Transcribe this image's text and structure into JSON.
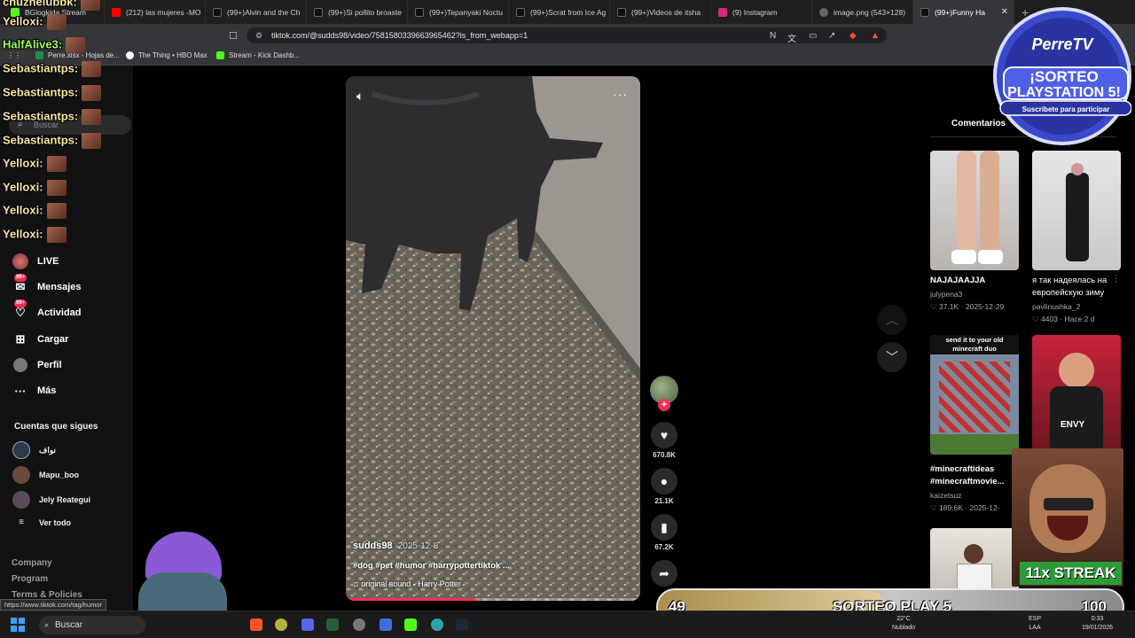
{
  "browser": {
    "tabs": [
      {
        "label": "BGlogkida Stream",
        "color": "#53fc18"
      },
      {
        "label": "(212) las mujeres -MO",
        "color": "#ff0000"
      },
      {
        "label": "(99+)Alvin and the Ch",
        "color": "#111111"
      },
      {
        "label": "(99+)Si pollito broaste",
        "color": "#111111"
      },
      {
        "label": "(99+)Tepanyaki Noctu",
        "color": "#111111"
      },
      {
        "label": "(99+)Scrat from Ice Ag",
        "color": "#111111"
      },
      {
        "label": "(99+)Videos de itsha",
        "color": "#111111"
      },
      {
        "label": "(9) Instagram",
        "color": "#d62976"
      },
      {
        "label": "image.png (543×128)",
        "color": "#666666"
      },
      {
        "label": "(99+)Funny Ha",
        "color": "#111111"
      }
    ],
    "url": "tiktok.com/@sudds98/video/7581580339663965462?is_from_webapp=1",
    "bookmarks": [
      {
        "label": "Perre.xlsx - Hojas de...",
        "color": "#1d8f4e"
      },
      {
        "label": "The Thing • HBO Max",
        "color": "#ffffff"
      },
      {
        "label": "Stream - Kick Dashb...",
        "color": "#53fc18"
      }
    ],
    "status_url": "https://www.tiktok.com/tag/humor"
  },
  "chat": [
    {
      "user": "chuzhelubbk:",
      "color": "#f6e6a0"
    },
    {
      "user": "Yelloxi:",
      "color": "#f6e6a0"
    },
    {
      "user": "HalfAlive3:",
      "color": "#9eff5a"
    },
    {
      "user": "Sebastiantps:",
      "color": "#f6e6a0"
    },
    {
      "user": "Sebastiantps:",
      "color": "#f6e6a0"
    },
    {
      "user": "Sebastiantps:",
      "color": "#f6e6a0"
    },
    {
      "user": "Sebastiantps:",
      "color": "#f6e6a0"
    },
    {
      "user": "Yelloxi:",
      "color": "#f6e6a0"
    },
    {
      "user": "Yelloxi:",
      "color": "#f6e6a0"
    },
    {
      "user": "Yelloxi:",
      "color": "#f6e6a0"
    },
    {
      "user": "Yelloxi:",
      "color": "#f6e6a0"
    }
  ],
  "sidebar": {
    "search_placeholder": "Buscar",
    "nav": [
      {
        "label": "LIVE",
        "icon": "live-icon"
      },
      {
        "label": "Mensajes",
        "icon": "messages-icon",
        "badge": "99+"
      },
      {
        "label": "Actividad",
        "icon": "activity-icon",
        "badge": "99+"
      },
      {
        "label": "Cargar",
        "icon": "upload-icon"
      },
      {
        "label": "Perfil",
        "icon": "profile-icon"
      },
      {
        "label": "Más",
        "icon": "more-icon"
      }
    ],
    "following_title": "Cuentas que sigues",
    "following": [
      {
        "name": "نواف"
      },
      {
        "name": "Mapu_boo"
      },
      {
        "name": "Jely Reategui"
      }
    ],
    "see_all": "Ver todo",
    "footer": [
      "Company",
      "Program",
      "Terms & Policies"
    ]
  },
  "video": {
    "author": "sudds98",
    "date": "2025-12-8",
    "tags": "#dog #pet #humor #harrypottertiktok ...",
    "sound": "original sound - Harry Potter",
    "progress": 0.44
  },
  "actions": {
    "likes": "670.8K",
    "comments": "21.1K",
    "saves": "67.2K"
  },
  "right_panel": {
    "tab": "Comentarios",
    "cards": [
      {
        "title": "NAJAJAAJJA",
        "author": "julypena3",
        "likes": "37.1K",
        "date": "2025-12-29"
      },
      {
        "title": "я так надеялась на европейскую зиму",
        "author": "pavlinushka_2",
        "likes": "4403",
        "date": "Hace 2 d"
      },
      {
        "title": "#minecraftideas #minecraftmovie...",
        "author": "kaizetsuz",
        "likes": "189.6K",
        "date": "2025-12-"
      },
      {
        "title": "",
        "author": "",
        "likes": "",
        "date": ""
      }
    ],
    "thumb_text_minecraft": "send it to your old minecraft duo",
    "thumb_text_envy": "ENVY"
  },
  "overlays": {
    "perretv_title": "PerreTV",
    "perretv_line1": "¡SORTEO",
    "perretv_line2": "PLAYSTATION 5!",
    "perretv_sub": "Suscríbete para participar",
    "streak": "11x STREAK",
    "raffle_left": "49",
    "raffle_center": "SORTEO PLAY 5",
    "raffle_right": "100",
    "raffle_progress": 0.49
  },
  "taskbar": {
    "search": "Buscar",
    "weather": "22°C",
    "weather_sub": "Nublado",
    "lang": "ESP",
    "lang_sub": "LAA",
    "time": "0:33",
    "date": "19/01/2026"
  }
}
